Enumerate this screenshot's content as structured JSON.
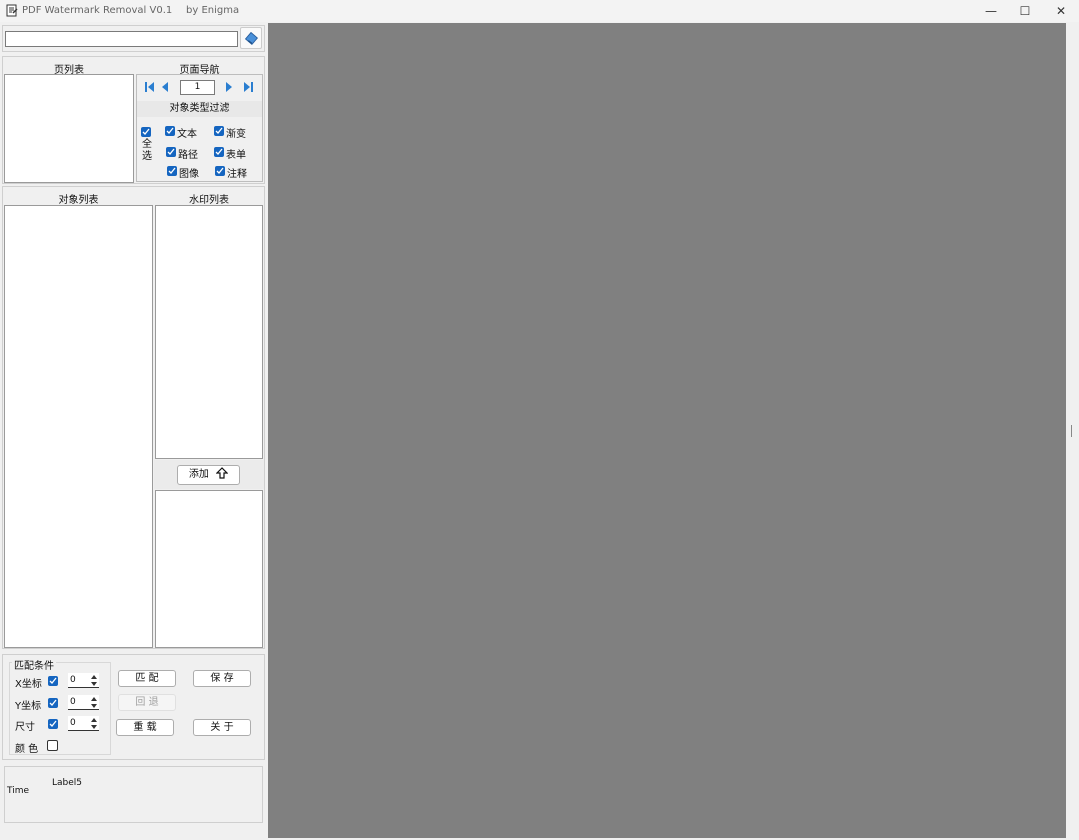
{
  "window": {
    "title": "PDF Watermark Removal   V0.1",
    "author": "by  Enigma",
    "minimize": "—",
    "maximize": "☐",
    "close": "✕"
  },
  "file": {
    "path_value": ""
  },
  "labels": {
    "page_list": "页列表",
    "page_nav": "页面导航",
    "type_filter": "对象类型过滤",
    "object_list": "对象列表",
    "watermark_list": "水印列表",
    "add_button": "添加",
    "match_conditions": "匹配条件",
    "time": "Time",
    "label5": "Label5"
  },
  "navigation": {
    "page_number": "1"
  },
  "filters": {
    "select_all": "全选",
    "text": "文本",
    "gradient": "渐变",
    "path": "路径",
    "form": "表单",
    "image": "图像",
    "annotation": "注释"
  },
  "match": {
    "x_label": "X坐标",
    "x_value": "0",
    "y_label": "Y坐标",
    "y_value": "0",
    "size_label": "尺寸",
    "size_value": "0",
    "color_label": "颜 色"
  },
  "actions": {
    "match": "匹 配",
    "save": "保 存",
    "rollback": "回 退",
    "reload": "重 载",
    "about": "关 于"
  },
  "colors": {
    "preview_bg": "#808080",
    "checkbox": "#1565c0"
  }
}
